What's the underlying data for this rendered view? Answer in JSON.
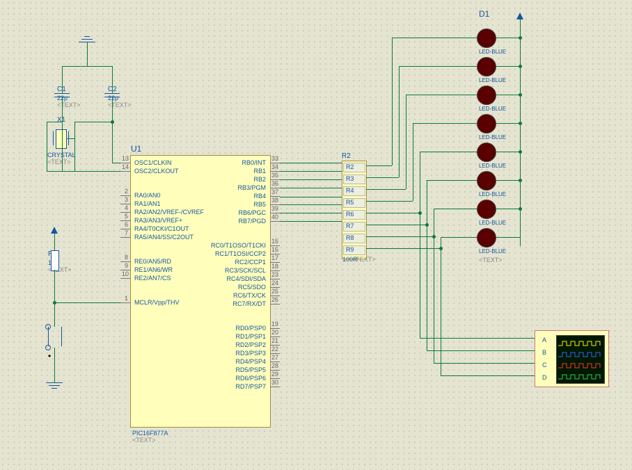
{
  "components": {
    "C1": {
      "ref": "C1",
      "value": "22p",
      "note": "<TEXT>"
    },
    "C2": {
      "ref": "C2",
      "value": "22p",
      "note": "<TEXT>"
    },
    "X1": {
      "ref": "X1",
      "value": "CRYSTAL",
      "note": "<TEXT>"
    },
    "U1": {
      "ref": "U1",
      "part": "PIC16F877A",
      "note": "<TEXT>"
    },
    "R1": {
      "ref": "R1",
      "value": "10k",
      "note": "<TEXT>"
    },
    "R2": {
      "ref": "R2",
      "value": "100R",
      "note": "<TEXT>",
      "rows": [
        "R2",
        "R3",
        "R4",
        "R5",
        "R6",
        "R7",
        "R8",
        "R9"
      ]
    },
    "D1": {
      "ref": "D1",
      "value": "LED-BLUE",
      "note": "<TEXT>",
      "labels": [
        "LED-BLUE",
        "LED-BLUE",
        "LED-BLUE",
        "LED-BLUE",
        "LED-BLUE",
        "LED-BLUE",
        "LED-BLUE",
        "LED-BLUE"
      ]
    }
  },
  "ic_pins_left": [
    {
      "num": "13",
      "name": "OSC1/CLKIN"
    },
    {
      "num": "14",
      "name": "OSC2/CLKOUT"
    },
    {
      "num": "",
      "name": ""
    },
    {
      "num": "2",
      "name": "RA0/AN0"
    },
    {
      "num": "3",
      "name": "RA1/AN1"
    },
    {
      "num": "4",
      "name": "RA2/AN2/VREF-/CVREF"
    },
    {
      "num": "5",
      "name": "RA3/AN3/VREF+"
    },
    {
      "num": "6",
      "name": "RA4/T0CKI/C1OUT"
    },
    {
      "num": "7",
      "name": "RA5/AN4/SS/C2OUT"
    },
    {
      "num": "",
      "name": ""
    },
    {
      "num": "8",
      "name": "RE0/AN5/RD"
    },
    {
      "num": "9",
      "name": "RE1/AN6/WR"
    },
    {
      "num": "10",
      "name": "RE2/AN7/CS"
    },
    {
      "num": "",
      "name": ""
    },
    {
      "num": "1",
      "name": "MCLR/Vpp/THV"
    }
  ],
  "ic_pins_right_top": [
    {
      "num": "33",
      "name": "RB0/INT"
    },
    {
      "num": "34",
      "name": "RB1"
    },
    {
      "num": "35",
      "name": "RB2"
    },
    {
      "num": "36",
      "name": "RB3/PGM"
    },
    {
      "num": "37",
      "name": "RB4"
    },
    {
      "num": "38",
      "name": "RB5"
    },
    {
      "num": "39",
      "name": "RB6/PGC"
    },
    {
      "num": "40",
      "name": "RB7/PGD"
    }
  ],
  "ic_pins_right_mid": [
    {
      "num": "15",
      "name": "RC0/T1OSO/T1CKI"
    },
    {
      "num": "16",
      "name": "RC1/T1OSI/CCP2"
    },
    {
      "num": "17",
      "name": "RC2/CCP1"
    },
    {
      "num": "18",
      "name": "RC3/SCK/SCL"
    },
    {
      "num": "23",
      "name": "RC4/SDI/SDA"
    },
    {
      "num": "24",
      "name": "RC5/SDO"
    },
    {
      "num": "25",
      "name": "RC6/TX/CK"
    },
    {
      "num": "26",
      "name": "RC7/RX/DT"
    }
  ],
  "ic_pins_right_bot": [
    {
      "num": "19",
      "name": "RD0/PSP0"
    },
    {
      "num": "20",
      "name": "RD1/PSP1"
    },
    {
      "num": "21",
      "name": "RD2/PSP2"
    },
    {
      "num": "22",
      "name": "RD3/PSP3"
    },
    {
      "num": "27",
      "name": "RD4/PSP4"
    },
    {
      "num": "28",
      "name": "RD5/PSP5"
    },
    {
      "num": "29",
      "name": "RD6/PSP6"
    },
    {
      "num": "30",
      "name": "RD7/PSP7"
    }
  ],
  "scope": {
    "channels": [
      "A",
      "B",
      "C",
      "D"
    ]
  }
}
